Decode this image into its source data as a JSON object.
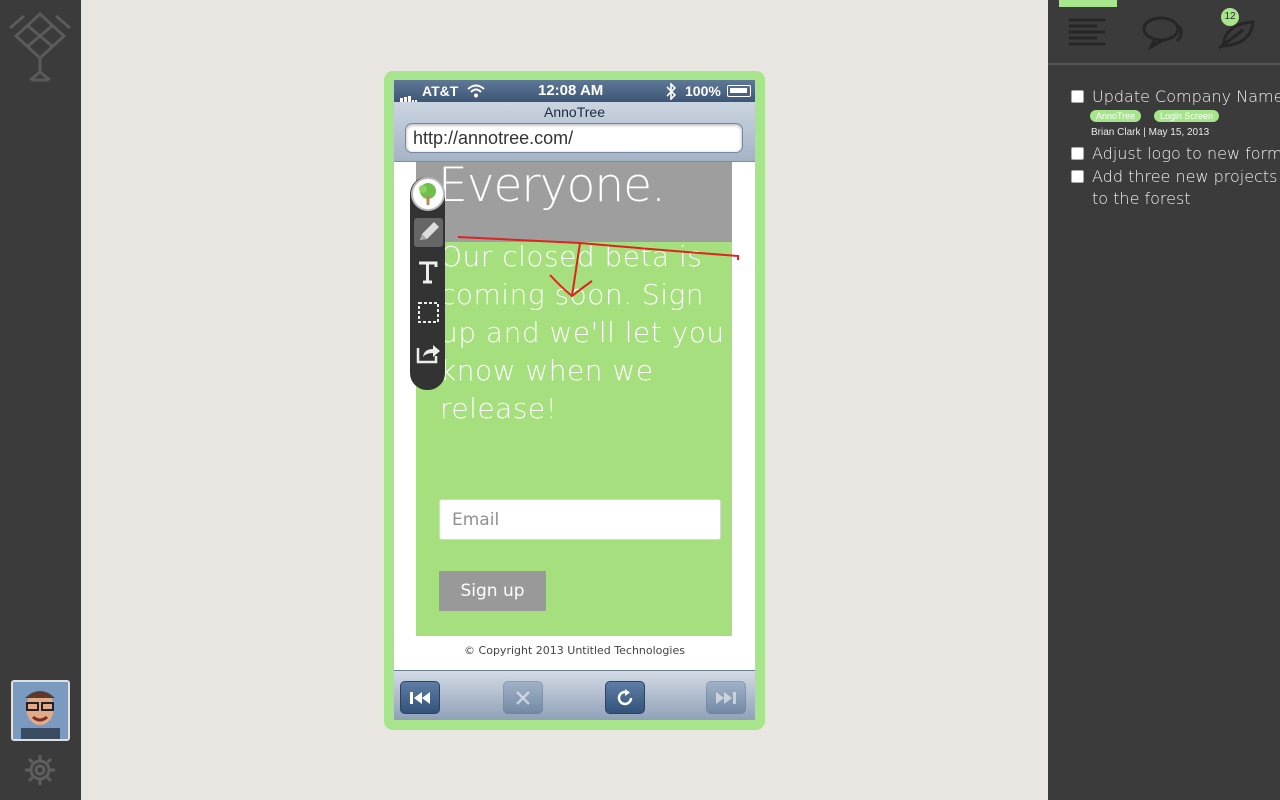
{
  "app": {
    "name": "AnnoTree",
    "accent_color": "#a6e58b"
  },
  "left_rail": {
    "logo_icon": "tree-logo-icon",
    "avatar": "user-avatar",
    "settings_icon": "gear-icon"
  },
  "phone": {
    "statusbar": {
      "carrier": "AT&T",
      "time": "12:08 AM",
      "battery": "100%"
    },
    "browser": {
      "title": "AnnoTree",
      "url": "http://annotree.com/"
    },
    "page": {
      "hero_text": "Everyone.",
      "beta_message": "Our closed beta is coming soon. Sign up and we'll let you know when we release!",
      "email_placeholder": "Email",
      "signup_label": "Sign up",
      "copyright": "© Copyright 2013 Untitled Technologies"
    },
    "toolbar": {
      "back_icon": "rewind-icon",
      "stop_icon": "close-icon",
      "reload_icon": "reload-icon",
      "forward_icon": "fast-forward-icon"
    }
  },
  "annotation_tools": [
    "tree-icon",
    "pencil-icon",
    "text-icon",
    "selection-icon",
    "share-icon"
  ],
  "right_panel": {
    "tabs": [
      "list-icon",
      "comments-icon",
      "leaf-icon"
    ],
    "badge_count": "12",
    "tasks": [
      {
        "label": "Update Company Name",
        "tags": [
          "AnnoTree",
          "Login Screen"
        ],
        "meta": "Brian Clark | May 15, 2013"
      },
      {
        "label": "Adjust logo to new format"
      },
      {
        "label_line1": "Add three new projects",
        "label_line2": "to the forest"
      }
    ]
  }
}
